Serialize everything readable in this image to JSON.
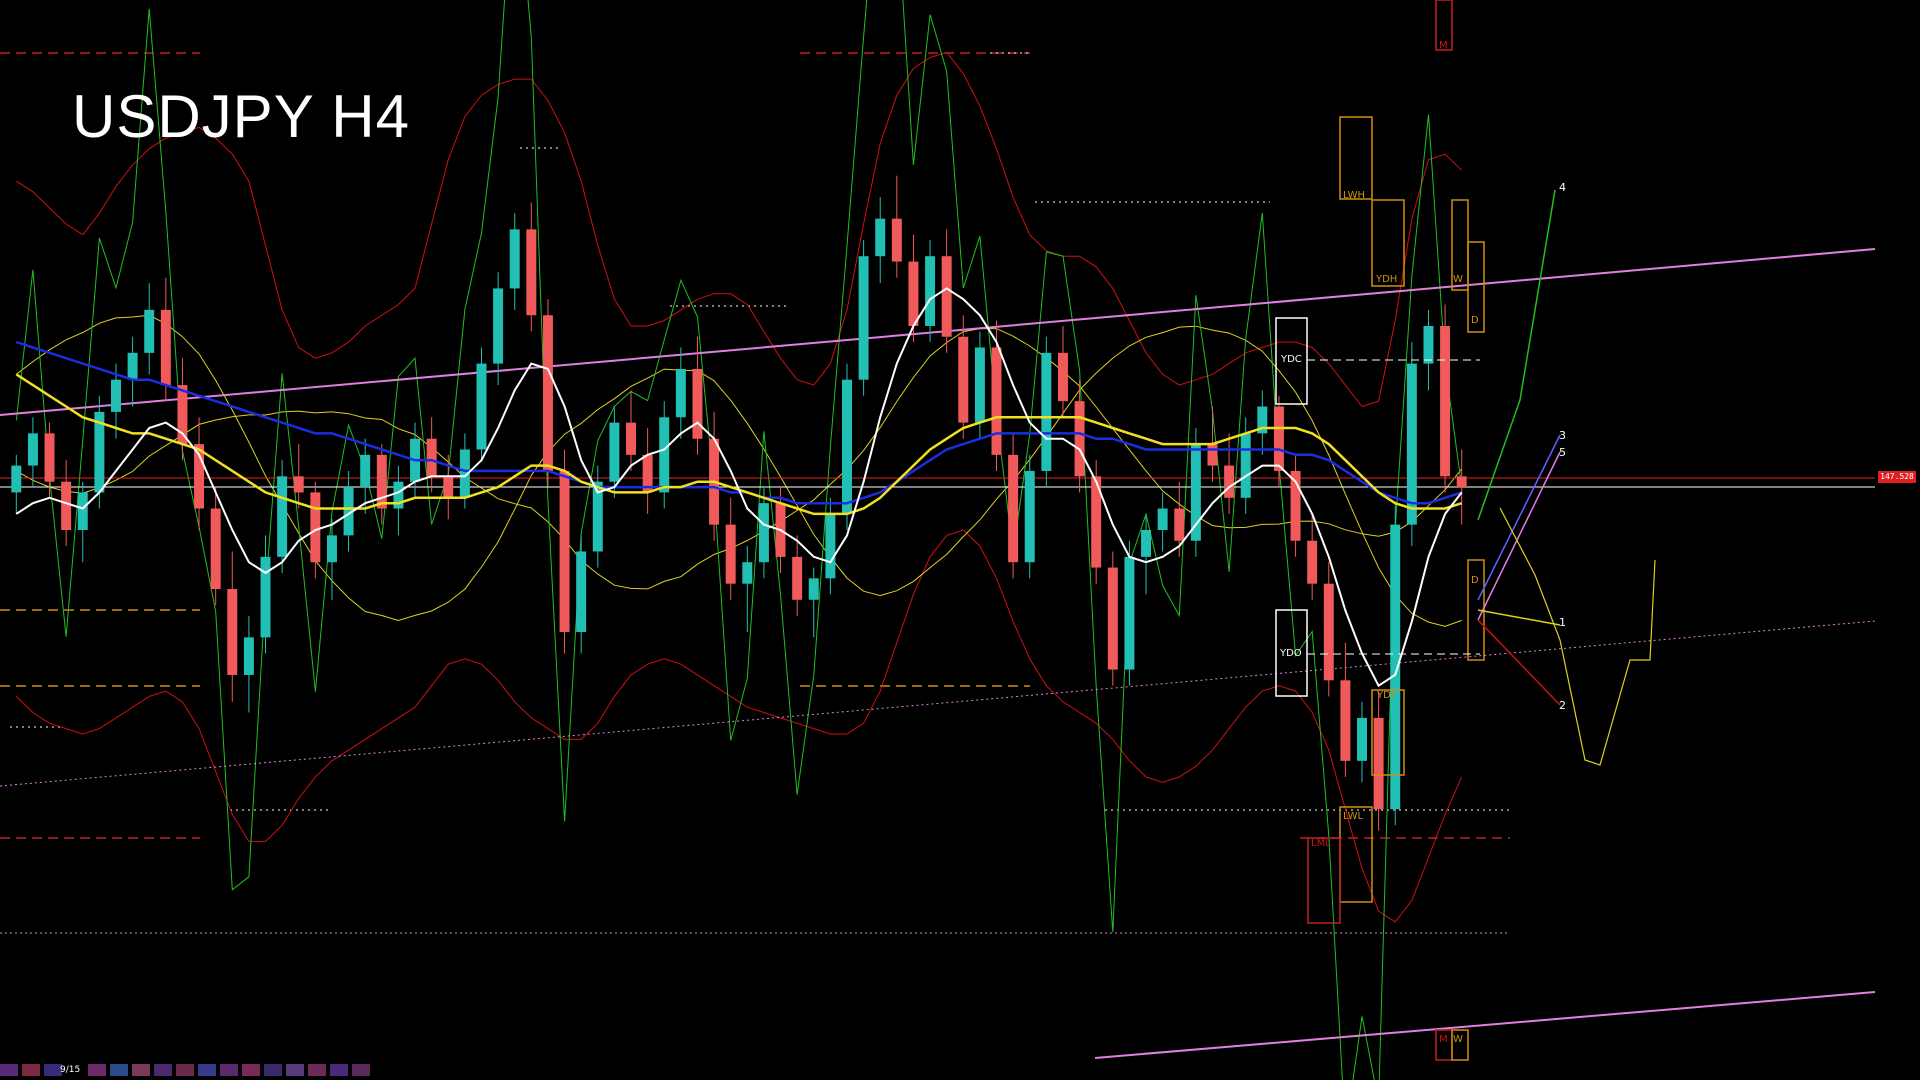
{
  "header": {
    "title": "USDJPY H4"
  },
  "price_tag": "147.528",
  "pager": {
    "label": "9/15"
  },
  "colors": {
    "bull": "#22c0b4",
    "bear": "#f05a5a",
    "white_ma": "#ffffff",
    "yellow_ma": "#f0e020",
    "blue_ma": "#1a2ee0",
    "bb": "#d01010",
    "osc": "#20c020",
    "channel": "#e080e0",
    "cloud_line": "#e0d020",
    "level_box": "#d09010"
  },
  "levels": {
    "LWH": "LWH",
    "YDH": "YDH",
    "YDC": "YDC",
    "YDO": "YDO",
    "YDL": "YDL",
    "LWL": "LWL",
    "LML": "LML",
    "W_top": "W",
    "D_top": "D",
    "D_mid": "D",
    "M_top": "M",
    "M_bot": "M",
    "W_bot": "W"
  },
  "waves": {
    "w1": "1",
    "w2": "2",
    "w3": "3",
    "w4": "4",
    "w5": "5"
  },
  "chart_data": {
    "type": "line",
    "title": "USDJPY H4",
    "grid": false,
    "last_price": 147.528,
    "candles": [
      [
        146.2,
        146.9,
        145.8,
        146.7
      ],
      [
        146.7,
        147.6,
        146.3,
        147.3
      ],
      [
        147.3,
        147.5,
        146.1,
        146.4
      ],
      [
        146.4,
        146.8,
        145.2,
        145.5
      ],
      [
        145.5,
        146.4,
        144.9,
        146.2
      ],
      [
        146.2,
        148.0,
        145.9,
        147.7
      ],
      [
        147.7,
        148.6,
        147.2,
        148.3
      ],
      [
        148.3,
        149.1,
        147.8,
        148.8
      ],
      [
        148.8,
        150.1,
        148.4,
        149.6
      ],
      [
        149.6,
        150.2,
        147.9,
        148.2
      ],
      [
        148.2,
        148.7,
        146.8,
        147.1
      ],
      [
        147.1,
        147.6,
        145.5,
        145.9
      ],
      [
        145.9,
        146.3,
        144.1,
        144.4
      ],
      [
        144.4,
        145.1,
        142.3,
        142.8
      ],
      [
        142.8,
        143.9,
        142.1,
        143.5
      ],
      [
        143.5,
        145.4,
        143.2,
        145.0
      ],
      [
        145.0,
        146.8,
        144.7,
        146.5
      ],
      [
        146.5,
        147.1,
        145.9,
        146.2
      ],
      [
        146.2,
        146.4,
        144.6,
        144.9
      ],
      [
        144.9,
        145.7,
        144.2,
        145.4
      ],
      [
        145.4,
        146.6,
        145.1,
        146.3
      ],
      [
        146.3,
        147.2,
        145.8,
        146.9
      ],
      [
        146.9,
        147.1,
        145.6,
        145.9
      ],
      [
        145.9,
        146.7,
        145.4,
        146.4
      ],
      [
        146.4,
        147.5,
        146.1,
        147.2
      ],
      [
        147.2,
        147.6,
        146.2,
        146.5
      ],
      [
        146.5,
        146.9,
        145.7,
        146.1
      ],
      [
        146.1,
        147.3,
        145.9,
        147.0
      ],
      [
        147.0,
        148.9,
        146.8,
        148.6
      ],
      [
        148.6,
        150.3,
        148.2,
        150.0
      ],
      [
        150.0,
        151.4,
        149.6,
        151.1
      ],
      [
        151.1,
        151.6,
        149.2,
        149.5
      ],
      [
        149.5,
        149.8,
        146.3,
        146.6
      ],
      [
        146.6,
        147.0,
        143.2,
        143.6
      ],
      [
        143.6,
        145.4,
        143.2,
        145.1
      ],
      [
        145.1,
        146.7,
        144.8,
        146.4
      ],
      [
        146.4,
        147.8,
        146.1,
        147.5
      ],
      [
        147.5,
        148.1,
        146.6,
        146.9
      ],
      [
        146.9,
        147.4,
        145.8,
        146.2
      ],
      [
        146.2,
        147.9,
        145.9,
        147.6
      ],
      [
        147.6,
        148.9,
        147.2,
        148.5
      ],
      [
        148.5,
        149.1,
        146.9,
        147.2
      ],
      [
        147.2,
        147.7,
        145.3,
        145.6
      ],
      [
        145.6,
        146.1,
        144.2,
        144.5
      ],
      [
        144.5,
        145.2,
        143.6,
        144.9
      ],
      [
        144.9,
        146.3,
        144.6,
        146.0
      ],
      [
        146.0,
        146.3,
        144.7,
        145.0
      ],
      [
        145.0,
        145.4,
        143.9,
        144.2
      ],
      [
        144.2,
        144.8,
        143.5,
        144.6
      ],
      [
        144.6,
        146.1,
        144.3,
        145.8
      ],
      [
        145.8,
        148.6,
        145.5,
        148.3
      ],
      [
        148.3,
        150.9,
        148.0,
        150.6
      ],
      [
        150.6,
        151.7,
        150.1,
        151.3
      ],
      [
        151.3,
        152.1,
        150.2,
        150.5
      ],
      [
        150.5,
        151.0,
        149.0,
        149.3
      ],
      [
        149.3,
        150.9,
        149.0,
        150.6
      ],
      [
        150.6,
        151.1,
        148.8,
        149.1
      ],
      [
        149.1,
        149.5,
        147.2,
        147.5
      ],
      [
        147.5,
        149.2,
        147.2,
        148.9
      ],
      [
        148.9,
        149.4,
        146.6,
        146.9
      ],
      [
        146.9,
        147.3,
        144.6,
        144.9
      ],
      [
        144.9,
        146.9,
        144.6,
        146.6
      ],
      [
        146.6,
        149.1,
        146.3,
        148.8
      ],
      [
        148.8,
        149.3,
        147.6,
        147.9
      ],
      [
        147.9,
        148.3,
        146.2,
        146.5
      ],
      [
        146.5,
        146.8,
        144.5,
        144.8
      ],
      [
        144.8,
        145.1,
        142.6,
        142.9
      ],
      [
        142.9,
        145.3,
        142.6,
        145.0
      ],
      [
        145.0,
        145.8,
        144.3,
        145.5
      ],
      [
        145.5,
        146.2,
        145.1,
        145.9
      ],
      [
        145.9,
        146.4,
        145.0,
        145.3
      ],
      [
        145.3,
        147.4,
        145.0,
        147.1
      ],
      [
        147.1,
        147.8,
        146.4,
        146.7
      ],
      [
        146.7,
        147.3,
        145.8,
        146.1
      ],
      [
        146.1,
        147.6,
        145.8,
        147.3
      ],
      [
        147.3,
        148.1,
        146.9,
        147.8
      ],
      [
        147.8,
        148.0,
        146.3,
        146.6
      ],
      [
        146.6,
        146.9,
        145.0,
        145.3
      ],
      [
        145.3,
        145.8,
        144.2,
        144.5
      ],
      [
        144.5,
        144.9,
        142.4,
        142.7
      ],
      [
        142.7,
        143.4,
        140.9,
        141.2
      ],
      [
        141.2,
        142.3,
        140.8,
        142.0
      ],
      [
        142.0,
        142.5,
        139.9,
        140.3
      ],
      [
        140.3,
        146.0,
        140.0,
        145.6
      ],
      [
        145.6,
        149.0,
        145.2,
        148.6
      ],
      [
        148.6,
        149.6,
        148.1,
        149.3
      ],
      [
        149.3,
        149.7,
        146.2,
        146.5
      ],
      [
        146.5,
        147.0,
        145.6,
        146.3
      ]
    ],
    "moving_averages": [
      {
        "name": "",
        "color": "#ffffff",
        "values": [
          145.8,
          146.0,
          146.1,
          146.0,
          145.9,
          146.2,
          146.6,
          147.0,
          147.4,
          147.5,
          147.3,
          146.9,
          146.2,
          145.5,
          144.9,
          144.7,
          144.9,
          145.3,
          145.5,
          145.6,
          145.8,
          146.0,
          146.1,
          146.2,
          146.4,
          146.5,
          146.5,
          146.5,
          146.8,
          147.4,
          148.1,
          148.6,
          148.5,
          147.8,
          146.8,
          146.2,
          146.3,
          146.7,
          146.9,
          147.0,
          147.3,
          147.5,
          147.2,
          146.6,
          145.9,
          145.6,
          145.5,
          145.3,
          145.0,
          144.9,
          145.4,
          146.4,
          147.6,
          148.6,
          149.3,
          149.8,
          150.0,
          149.8,
          149.5,
          149.0,
          148.2,
          147.5,
          147.2,
          147.2,
          147.0,
          146.4,
          145.6,
          145.0,
          144.9,
          145.0,
          145.2,
          145.6,
          146.0,
          146.3,
          146.5,
          146.7,
          146.7,
          146.4,
          145.8,
          145.0,
          144.0,
          143.2,
          142.6,
          142.8,
          143.8,
          145.0,
          145.8,
          146.2
        ]
      },
      {
        "name": "",
        "color": "#f0e020",
        "values": [
          148.4,
          148.2,
          148.0,
          147.8,
          147.6,
          147.5,
          147.4,
          147.3,
          147.3,
          147.2,
          147.1,
          147.0,
          146.8,
          146.6,
          146.4,
          146.2,
          146.1,
          146.0,
          145.9,
          145.9,
          145.9,
          145.9,
          146.0,
          146.0,
          146.1,
          146.1,
          146.1,
          146.1,
          146.2,
          146.3,
          146.5,
          146.7,
          146.7,
          146.6,
          146.4,
          146.3,
          146.2,
          146.2,
          146.2,
          146.3,
          146.3,
          146.4,
          146.4,
          146.3,
          146.2,
          146.1,
          146.0,
          145.9,
          145.8,
          145.8,
          145.8,
          145.9,
          146.1,
          146.4,
          146.7,
          147.0,
          147.2,
          147.4,
          147.5,
          147.6,
          147.6,
          147.6,
          147.6,
          147.6,
          147.6,
          147.5,
          147.4,
          147.3,
          147.2,
          147.1,
          147.1,
          147.1,
          147.1,
          147.2,
          147.3,
          147.4,
          147.4,
          147.4,
          147.3,
          147.1,
          146.8,
          146.5,
          146.2,
          146.0,
          145.9,
          145.9,
          145.9,
          146.0
        ]
      },
      {
        "name": "",
        "color": "#1a2ee0",
        "values": [
          149.0,
          148.9,
          148.8,
          148.7,
          148.6,
          148.5,
          148.4,
          148.3,
          148.3,
          148.2,
          148.1,
          148.0,
          147.9,
          147.8,
          147.7,
          147.6,
          147.5,
          147.4,
          147.3,
          147.3,
          147.2,
          147.1,
          147.0,
          146.9,
          146.8,
          146.8,
          146.7,
          146.6,
          146.6,
          146.6,
          146.6,
          146.6,
          146.6,
          146.5,
          146.4,
          146.3,
          146.3,
          146.3,
          146.3,
          146.3,
          146.3,
          146.3,
          146.3,
          146.2,
          146.2,
          146.1,
          146.1,
          146.0,
          146.0,
          146.0,
          146.0,
          146.1,
          146.2,
          146.4,
          146.6,
          146.8,
          147.0,
          147.1,
          147.2,
          147.3,
          147.3,
          147.3,
          147.3,
          147.3,
          147.3,
          147.2,
          147.2,
          147.1,
          147.0,
          147.0,
          147.0,
          147.0,
          147.0,
          147.0,
          147.0,
          147.0,
          147.0,
          146.9,
          146.9,
          146.8,
          146.6,
          146.4,
          146.2,
          146.1,
          146.0,
          146.0,
          146.1,
          146.2
        ]
      }
    ],
    "bollinger": {
      "upper": [
        152.0,
        151.8,
        151.5,
        151.2,
        151.0,
        151.4,
        151.9,
        152.3,
        152.6,
        152.8,
        152.9,
        153.0,
        152.8,
        152.5,
        152.0,
        150.8,
        149.6,
        148.9,
        148.7,
        148.8,
        149.0,
        149.3,
        149.5,
        149.7,
        150.0,
        151.2,
        152.4,
        153.2,
        153.6,
        153.8,
        153.9,
        153.9,
        153.5,
        152.9,
        152.0,
        150.8,
        149.8,
        149.3,
        149.3,
        149.4,
        149.6,
        149.8,
        149.9,
        149.9,
        149.7,
        149.2,
        148.7,
        148.3,
        148.2,
        148.6,
        149.6,
        151.2,
        152.7,
        153.6,
        154.1,
        154.3,
        154.4,
        154.0,
        153.4,
        152.6,
        151.7,
        151.0,
        150.7,
        150.6,
        150.6,
        150.4,
        150.0,
        149.4,
        148.8,
        148.4,
        148.2,
        148.3,
        148.4,
        148.6,
        148.8,
        148.9,
        149.0,
        149.0,
        148.9,
        148.6,
        148.2,
        147.8,
        147.9,
        149.4,
        151.3,
        152.4,
        152.5,
        152.2
      ],
      "lower": [
        142.4,
        142.1,
        141.9,
        141.8,
        141.7,
        141.8,
        142.0,
        142.2,
        142.4,
        142.5,
        142.3,
        141.8,
        141.0,
        140.2,
        139.7,
        139.7,
        140.0,
        140.5,
        140.9,
        141.2,
        141.4,
        141.6,
        141.8,
        142.0,
        142.2,
        142.6,
        143.0,
        143.1,
        143.0,
        142.7,
        142.3,
        142.0,
        141.8,
        141.6,
        141.6,
        141.9,
        142.4,
        142.8,
        143.0,
        143.1,
        143.0,
        142.8,
        142.6,
        142.4,
        142.2,
        142.1,
        142.0,
        141.9,
        141.8,
        141.7,
        141.7,
        141.9,
        142.5,
        143.4,
        144.3,
        145.0,
        145.4,
        145.5,
        145.2,
        144.6,
        143.8,
        143.1,
        142.6,
        142.3,
        142.1,
        141.9,
        141.6,
        141.2,
        140.9,
        140.8,
        140.9,
        141.1,
        141.4,
        141.8,
        142.2,
        142.5,
        142.6,
        142.5,
        142.1,
        141.4,
        140.3,
        139.2,
        138.4,
        138.2,
        138.6,
        139.4,
        140.2,
        140.9
      ]
    }
  }
}
